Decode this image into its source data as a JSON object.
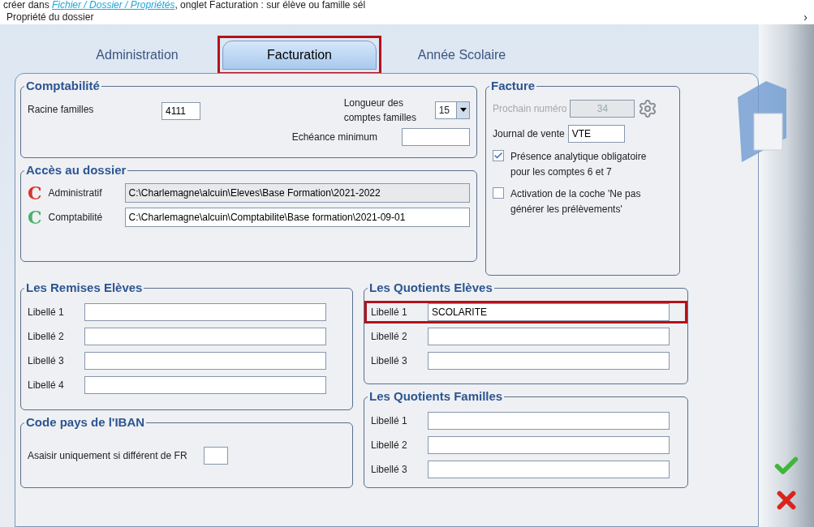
{
  "doc_line": {
    "before": "créer dans ",
    "link": "Fichier / Dossier / Propriétés",
    "after": ", onglet Facturation : sur élève ou famille sél"
  },
  "window": {
    "title": "Propriété du dossier",
    "close": "›"
  },
  "tabs": [
    {
      "label": "Administration",
      "selected": false,
      "highlighted": false
    },
    {
      "label": "Facturation",
      "selected": true,
      "highlighted": true
    },
    {
      "label": "Année Scolaire",
      "selected": false,
      "highlighted": false
    }
  ],
  "comptabilite": {
    "title": "Comptabilité",
    "racine_label": "Racine familles",
    "racine_value": "4111",
    "longueur_label": "Longueur des comptes familles",
    "longueur_value": "15",
    "echeance_label": "Echéance minimum"
  },
  "acces": {
    "title": "Accès au dossier",
    "rows": [
      {
        "logo": "C",
        "color": "#d9342b",
        "label": "Administratif",
        "value": "C:\\Charlemagne\\alcuin\\Eleves\\Base Formation\\2021-2022",
        "disabled": true
      },
      {
        "logo": "C",
        "color": "#4caf6a",
        "label": "Comptabilité",
        "value": "C:\\Charlemagne\\alcuin\\Comptabilite\\Base formation\\2021-09-01",
        "disabled": false
      }
    ]
  },
  "facture": {
    "title": "Facture",
    "prochain_label": "Prochain numéro",
    "prochain_value": "34",
    "prochain_disabled": true,
    "journal_label": "Journal de vente",
    "journal_value": "VTE",
    "checks": [
      {
        "label": "Présence analytique obligatoire pour les comptes 6 et 7",
        "checked": true
      },
      {
        "label": "Activation de la coche 'Ne pas générer les prélèvements'",
        "checked": false
      }
    ]
  },
  "remises": {
    "title": "Les Remises Elèves",
    "rows": [
      {
        "label": "Libellé 1",
        "value": "",
        "highlighted": false
      },
      {
        "label": "Libellé 2",
        "value": "",
        "highlighted": false
      },
      {
        "label": "Libellé 3",
        "value": "",
        "highlighted": false
      },
      {
        "label": "Libellé 4",
        "value": "",
        "highlighted": false
      }
    ]
  },
  "iban": {
    "title": "Code pays de l'IBAN",
    "label": "Asaisir uniquement si différent de FR"
  },
  "quotients_eleves": {
    "title": "Les Quotients Elèves",
    "rows": [
      {
        "label": "Libellé 1",
        "value": "SCOLARITE",
        "highlighted": true
      },
      {
        "label": "Libellé 2",
        "value": "",
        "highlighted": false
      },
      {
        "label": "Libellé 3",
        "value": "",
        "highlighted": false
      }
    ]
  },
  "quotients_familles": {
    "title": "Les Quotients Familles",
    "rows": [
      {
        "label": "Libellé 1",
        "value": "",
        "highlighted": false
      },
      {
        "label": "Libellé 2",
        "value": "",
        "highlighted": false
      },
      {
        "label": "Libellé 3",
        "value": "",
        "highlighted": false
      }
    ]
  }
}
